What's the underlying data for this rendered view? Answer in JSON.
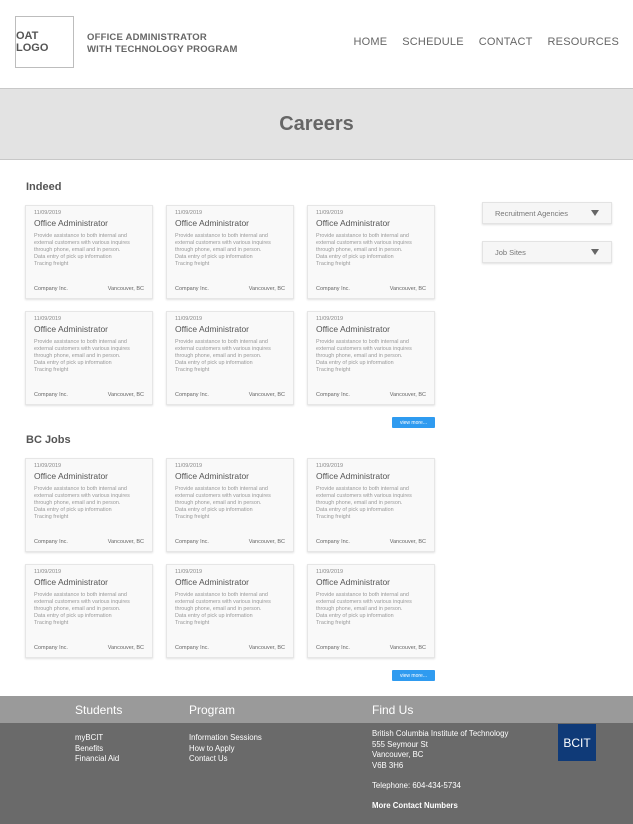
{
  "header": {
    "logo": "OAT LOGO",
    "program_line1": "OFFICE ADMINISTRATOR",
    "program_line2": "WITH TECHNOLOGY PROGRAM",
    "nav": [
      "HOME",
      "SCHEDULE",
      "CONTACT",
      "RESOURCES"
    ]
  },
  "hero": {
    "title": "Careers"
  },
  "sections": [
    {
      "heading": "Indeed",
      "view_more": "view more...",
      "cards": [
        {
          "date": "11/09/2019",
          "title": "Office Administrator",
          "desc": [
            "Provide assistance to both internal and",
            "external customers with various inquires",
            "through phone, email and in person.",
            "Data entry of pick up information",
            "Tracing freight"
          ],
          "company": "Company Inc.",
          "location": "Vancouver, BC"
        },
        {
          "date": "11/09/2019",
          "title": "Office Administrator",
          "desc": [
            "Provide assistance to both internal and",
            "external customers with various inquires",
            "through phone, email and in person.",
            "Data entry of pick up information",
            "Tracing freight"
          ],
          "company": "Company Inc.",
          "location": "Vancouver, BC"
        },
        {
          "date": "11/09/2019",
          "title": "Office Administrator",
          "desc": [
            "Provide assistance to both internal and",
            "external customers with various inquires",
            "through phone, email and in person.",
            "Data entry of pick up information",
            "Tracing freight"
          ],
          "company": "Company Inc.",
          "location": "Vancouver, BC"
        },
        {
          "date": "11/09/2019",
          "title": "Office Administrator",
          "desc": [
            "Provide assistance to both internal and",
            "external customers with various inquires",
            "through phone, email and in person.",
            "Data entry of pick up information",
            "Tracing freight"
          ],
          "company": "Company Inc.",
          "location": "Vancouver, BC"
        },
        {
          "date": "11/09/2019",
          "title": "Office Administrator",
          "desc": [
            "Provide assistance to both internal and",
            "external customers with various inquires",
            "through phone, email and in person.",
            "Data entry of pick up information",
            "Tracing freight"
          ],
          "company": "Company Inc.",
          "location": "Vancouver, BC"
        },
        {
          "date": "11/09/2019",
          "title": "Office Administrator",
          "desc": [
            "Provide assistance to both internal and",
            "external customers with various inquires",
            "through phone, email and in person.",
            "Data entry of pick up information",
            "Tracing freight"
          ],
          "company": "Company Inc.",
          "location": "Vancouver, BC"
        }
      ]
    },
    {
      "heading": "BC Jobs",
      "view_more": "view more...",
      "cards": [
        {
          "date": "11/09/2019",
          "title": "Office Administrator",
          "desc": [
            "Provide assistance to both internal and",
            "external customers with various inquires",
            "through phone, email and in person.",
            "Data entry of pick up information",
            "Tracing freight"
          ],
          "company": "Company Inc.",
          "location": "Vancouver, BC"
        },
        {
          "date": "11/09/2019",
          "title": "Office Administrator",
          "desc": [
            "Provide assistance to both internal and",
            "external customers with various inquires",
            "through phone, email and in person.",
            "Data entry of pick up information",
            "Tracing freight"
          ],
          "company": "Company Inc.",
          "location": "Vancouver, BC"
        },
        {
          "date": "11/09/2019",
          "title": "Office Administrator",
          "desc": [
            "Provide assistance to both internal and",
            "external customers with various inquires",
            "through phone, email and in person.",
            "Data entry of pick up information",
            "Tracing freight"
          ],
          "company": "Company Inc.",
          "location": "Vancouver, BC"
        },
        {
          "date": "11/09/2019",
          "title": "Office Administrator",
          "desc": [
            "Provide assistance to both internal and",
            "external customers with various inquires",
            "through phone, email and in person.",
            "Data entry of pick up information",
            "Tracing freight"
          ],
          "company": "Company Inc.",
          "location": "Vancouver, BC"
        },
        {
          "date": "11/09/2019",
          "title": "Office Administrator",
          "desc": [
            "Provide assistance to both internal and",
            "external customers with various inquires",
            "through phone, email and in person.",
            "Data entry of pick up information",
            "Tracing freight"
          ],
          "company": "Company Inc.",
          "location": "Vancouver, BC"
        },
        {
          "date": "11/09/2019",
          "title": "Office Administrator",
          "desc": [
            "Provide assistance to both internal and",
            "external customers with various inquires",
            "through phone, email and in person.",
            "Data entry of pick up information",
            "Tracing freight"
          ],
          "company": "Company Inc.",
          "location": "Vancouver, BC"
        }
      ]
    }
  ],
  "sidebar": {
    "dropdowns": [
      {
        "label": "Recruitment Agencies",
        "icon": "caret-down-icon"
      },
      {
        "label": "Job Sites",
        "icon": "caret-down-icon"
      }
    ]
  },
  "footer": {
    "students": {
      "heading": "Students",
      "links": [
        "myBCIT",
        "Benefits",
        "Financial Aid"
      ]
    },
    "program": {
      "heading": "Program",
      "links": [
        "Information Sessions",
        "How to Apply",
        "Contact Us"
      ]
    },
    "find_us": {
      "heading": "Find Us",
      "address": [
        "British Columbia Institute of Technology",
        "555 Seymour St",
        "Vancouver, BC",
        "V6B 3H6"
      ],
      "phone": "Telephone: 604-434-5734",
      "more": "More Contact Numbers"
    },
    "logo": "BCIT",
    "colors": {
      "top_bar": "#9a9a9a",
      "main": "#6a6a6a",
      "logo_bg": "#0f3a78"
    }
  },
  "colors": {
    "accent": "#2f9bf0",
    "hero_bg": "#e3e3e3"
  }
}
